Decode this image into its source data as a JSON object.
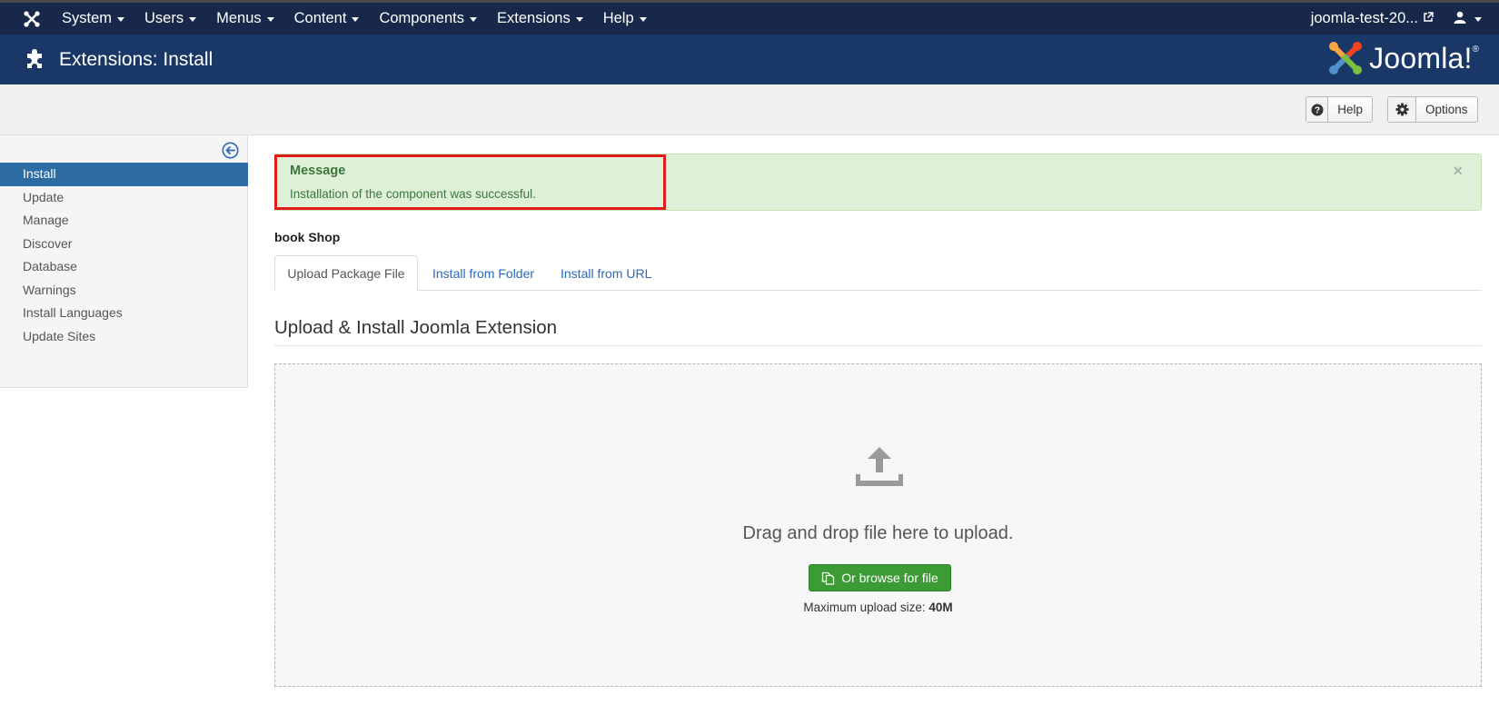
{
  "topbar": {
    "menu": [
      "System",
      "Users",
      "Menus",
      "Content",
      "Components",
      "Extensions",
      "Help"
    ],
    "site_link": "joomla-test-20...",
    "icons": {
      "logo": "joomla-mini-icon",
      "external": "external-link-icon",
      "user": "user-icon"
    }
  },
  "header": {
    "title": "Extensions: Install",
    "logo_text": "Joomla!",
    "logo_reg": "®"
  },
  "toolbar": {
    "help_label": "Help",
    "options_label": "Options"
  },
  "sidebar": {
    "items": [
      {
        "label": "Install",
        "active": true
      },
      {
        "label": "Update"
      },
      {
        "label": "Manage"
      },
      {
        "label": "Discover"
      },
      {
        "label": "Database"
      },
      {
        "label": "Warnings"
      },
      {
        "label": "Install Languages"
      },
      {
        "label": "Update Sites"
      }
    ]
  },
  "alert": {
    "heading": "Message",
    "text": "Installation of the component was successful.",
    "close": "×"
  },
  "extension_name": "book Shop",
  "tabs": [
    "Upload Package File",
    "Install from Folder",
    "Install from URL"
  ],
  "section_title": "Upload & Install Joomla Extension",
  "dropzone": {
    "text": "Drag and drop file here to upload.",
    "browse_label": "Or browse for file",
    "max_size_label": "Maximum upload size:",
    "max_size_value": "40M"
  },
  "colors": {
    "navbar": "#17284a",
    "header": "#1a3867",
    "sidebar_active": "#2d6ca2",
    "alert_bg": "#dff0d8",
    "alert_text": "#3c763d",
    "highlight": "#e01b1b",
    "browse_button": "#3d9b35",
    "link": "#2a69b8"
  }
}
